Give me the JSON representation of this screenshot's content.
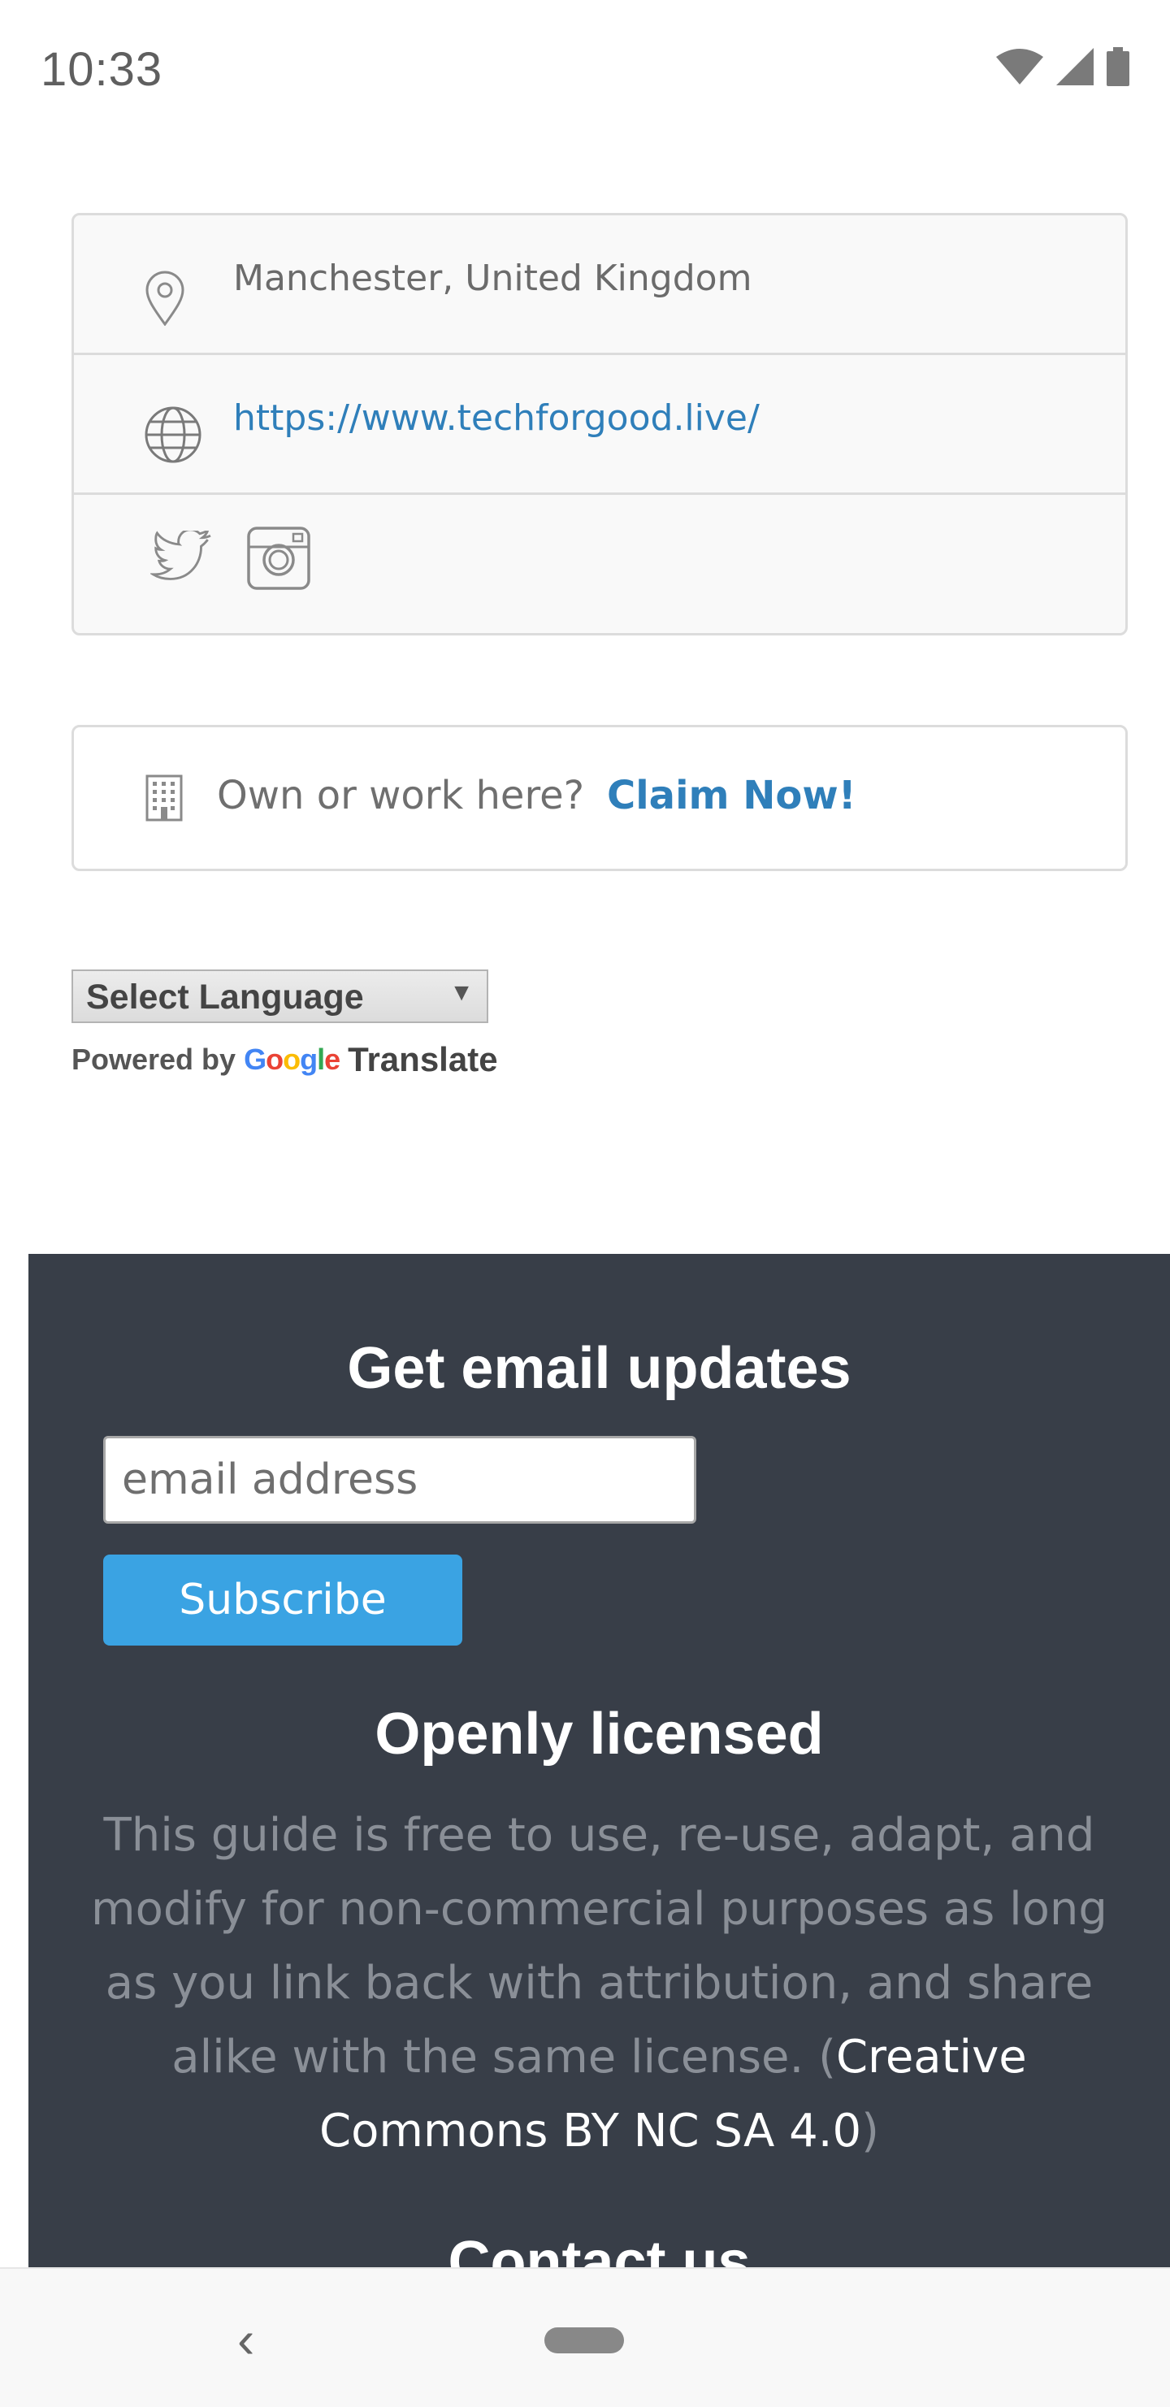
{
  "status_bar": {
    "time": "10:33"
  },
  "location_card": {
    "address": "Manchester, United Kingdom",
    "website": "https://www.techforgood.live/",
    "social_icons": [
      "twitter-icon",
      "instagram-icon"
    ]
  },
  "claim_card": {
    "question": "Own or work here?",
    "link_label": "Claim Now!"
  },
  "translate": {
    "select_label": "Select Language",
    "powered_by": "Powered by",
    "google": "Google",
    "translate": "Translate"
  },
  "footer": {
    "email_heading": "Get email updates",
    "email_placeholder": "email address",
    "subscribe_label": "Subscribe",
    "license_heading": "Openly licensed",
    "license_text": "This guide is free to use, re-use, adapt, and modify for non-commercial purposes as long as you link back with attribution, and share alike with the same license. (",
    "license_link": "Creative Commons BY NC SA 4.0",
    "license_close": ")",
    "contact_heading": "Contact us"
  },
  "colors": {
    "link": "#2f7fba",
    "footer_bg": "#383e48",
    "subscribe_bg": "#3aa3e3"
  }
}
